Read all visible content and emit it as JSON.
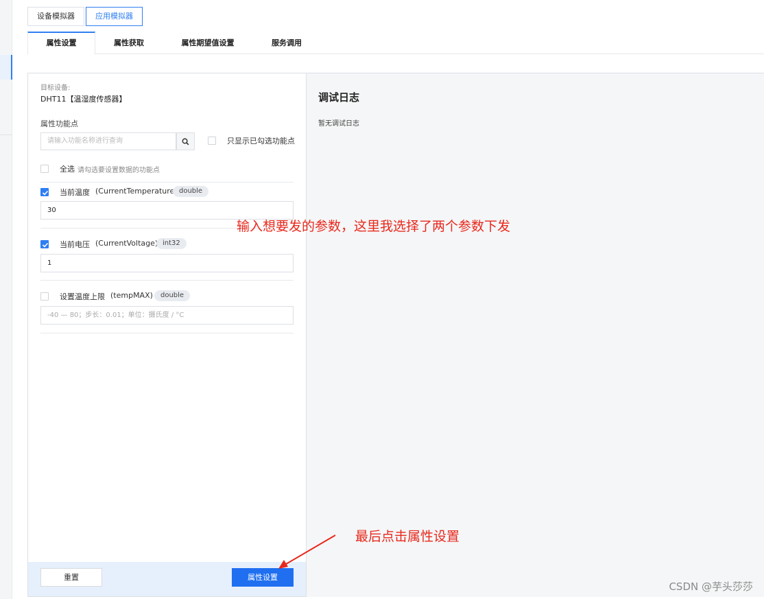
{
  "mode_tabs": [
    "设备模拟器",
    "应用模拟器"
  ],
  "tabs": [
    "属性设置",
    "属性获取",
    "属性期望值设置",
    "服务调用"
  ],
  "target": {
    "label": "目标设备:",
    "device": "DHT11【温湿度传感器】"
  },
  "props_section": {
    "title": "属性功能点",
    "search_placeholder": "请输入功能名称进行查询",
    "only_checked": "只显示已勾选功能点",
    "select_all": "全选",
    "select_all_hint": "请勾选要设置数据的功能点"
  },
  "properties": [
    {
      "name": "当前温度",
      "id": "(CurrentTemperature)",
      "type": "double",
      "checked": true,
      "value": "30",
      "placeholder": ""
    },
    {
      "name": "当前电压",
      "id": "(CurrentVoltage)",
      "type": "int32",
      "checked": true,
      "value": "1",
      "placeholder": ""
    },
    {
      "name": "设置温度上限",
      "id": "(tempMAX)",
      "type": "double",
      "checked": false,
      "value": "",
      "placeholder": "-40 — 80；步长：0.01；单位：摄氏度 / °C"
    }
  ],
  "footer": {
    "reset": "重置",
    "submit": "属性设置"
  },
  "log": {
    "title": "调试日志",
    "empty": "暂无调试日志"
  },
  "annotations": {
    "params": "输入想要发的参数，这里我选择了两个参数下发",
    "click": "最后点击属性设置"
  },
  "watermark": "CSDN @芋头莎莎",
  "colors": {
    "accent": "#2f7ef2",
    "primary_button": "#1f6ff0",
    "annotation": "#e8281c"
  }
}
